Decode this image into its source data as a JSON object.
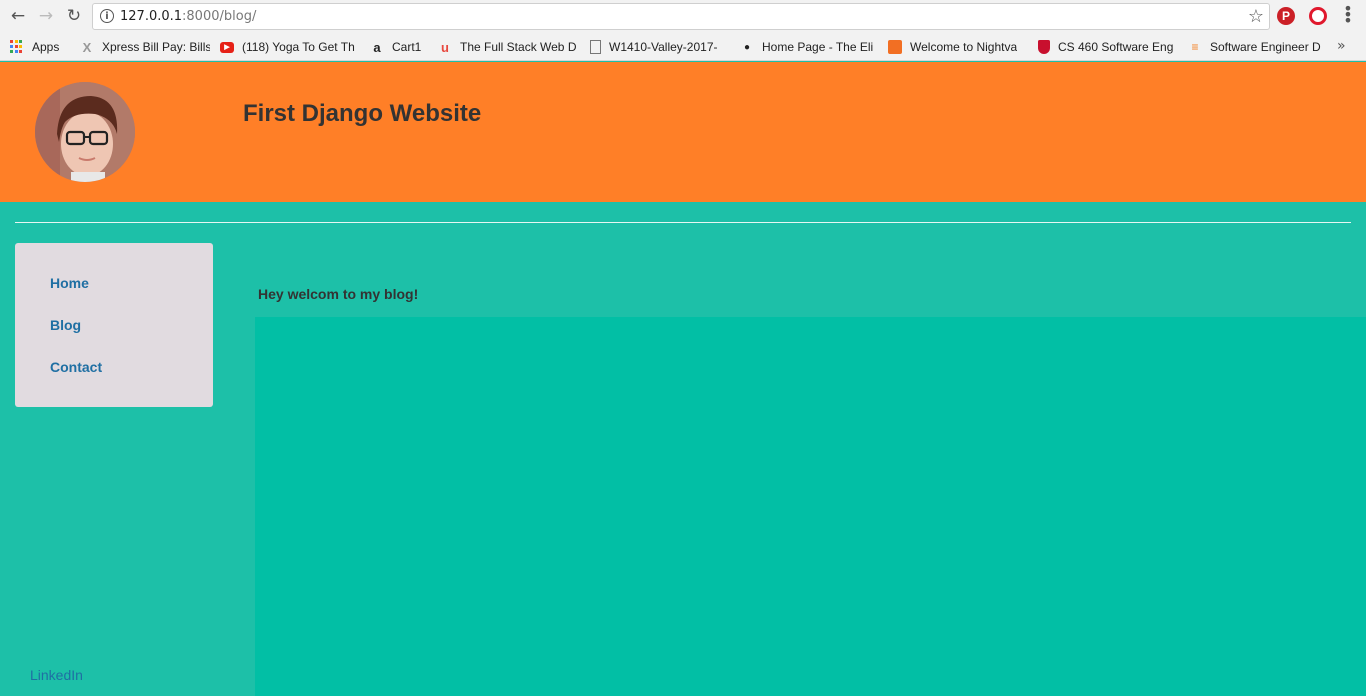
{
  "browser": {
    "url_host": "127.0.0.1",
    "url_rest": ":8000/blog/",
    "bookmarks": [
      {
        "label": "Apps",
        "icon": "apps-grid-icon"
      },
      {
        "label": "Xpress Bill Pay: Bills",
        "icon": "xpress-icon"
      },
      {
        "label": "(118) Yoga To Get Th",
        "icon": "youtube-icon"
      },
      {
        "label": "Cart1",
        "icon": "amazon-icon"
      },
      {
        "label": "The Full Stack Web D",
        "icon": "udemy-icon"
      },
      {
        "label": "W1410-Valley-2017-",
        "icon": "page-icon"
      },
      {
        "label": "Home Page - The Eli",
        "icon": "ninja-icon"
      },
      {
        "label": "Welcome to Nightva",
        "icon": "soundcloud-icon"
      },
      {
        "label": "CS 460 Software Eng",
        "icon": "shield-icon"
      },
      {
        "label": "Software Engineer D",
        "icon": "stackoverflow-icon"
      }
    ],
    "colors": {
      "chrome": "#f2f2f2"
    }
  },
  "header": {
    "title": "First Django Website",
    "color": "#ff7f27"
  },
  "sidebar": {
    "items": [
      {
        "label": "Home"
      },
      {
        "label": "Blog"
      },
      {
        "label": "Contact"
      }
    ],
    "footer_link": "LinkedIn"
  },
  "main": {
    "welcome_text": "Hey welcom to my blog!"
  },
  "colors": {
    "page_bg": "#1dc0a8",
    "content_band": "#02bfa5",
    "nav_panel": "#e1dbe0",
    "link": "#1f6fa3"
  }
}
